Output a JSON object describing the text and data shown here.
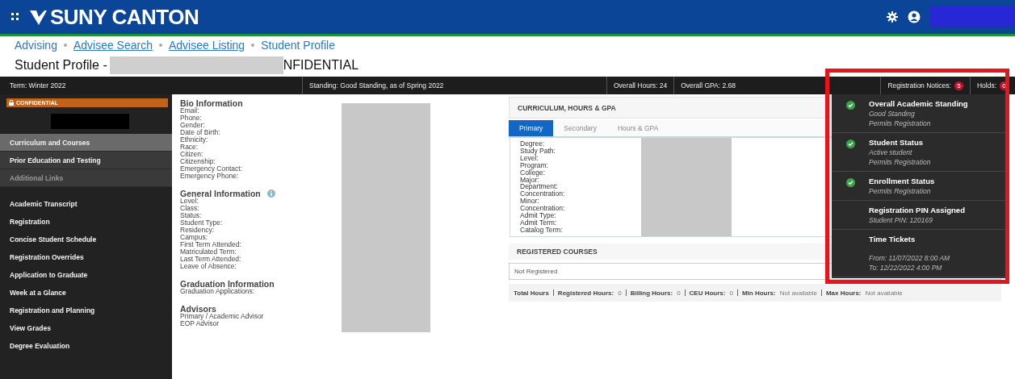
{
  "header": {
    "logo": "SUNY CANTON"
  },
  "breadcrumb": [
    {
      "label": "Advising",
      "link": false
    },
    {
      "label": "Advisee Search",
      "link": true
    },
    {
      "label": "Advisee Listing",
      "link": true
    },
    {
      "label": "Student Profile",
      "link": false
    }
  ],
  "page_title": {
    "prefix": "Student Profile -",
    "suffix": "NFIDENTIAL"
  },
  "info_bar": {
    "term": "Term: Winter 2022",
    "standing": "Standing: Good Standing, as of Spring 2022",
    "hours": "Overall Hours: 24",
    "gpa": "Overall GPA: 2.68",
    "notices_label": "Registration Notices:",
    "notices_count": "5",
    "holds_label": "Holds:",
    "holds_count": "0"
  },
  "sidebar": {
    "badge": "CONFIDENTIAL",
    "items": [
      {
        "label": "Curriculum and Courses",
        "kind": "section",
        "selected": true,
        "disabled": false
      },
      {
        "label": "Prior Education and Testing",
        "kind": "section",
        "selected": false,
        "disabled": false
      },
      {
        "label": "Additional Links",
        "kind": "section",
        "selected": false,
        "disabled": true
      },
      {
        "label": "Academic Transcript",
        "kind": "link",
        "selected": false,
        "disabled": false
      },
      {
        "label": "Registration",
        "kind": "link",
        "selected": false,
        "disabled": false
      },
      {
        "label": "Concise Student Schedule",
        "kind": "link",
        "selected": false,
        "disabled": false
      },
      {
        "label": "Registration Overrides",
        "kind": "link",
        "selected": false,
        "disabled": false
      },
      {
        "label": "Application to Graduate",
        "kind": "link",
        "selected": false,
        "disabled": false
      },
      {
        "label": "Week at a Glance",
        "kind": "link",
        "selected": false,
        "disabled": false
      },
      {
        "label": "Registration and Planning",
        "kind": "link",
        "selected": false,
        "disabled": false
      },
      {
        "label": "View Grades",
        "kind": "link",
        "selected": false,
        "disabled": false
      },
      {
        "label": "Degree Evaluation",
        "kind": "link",
        "selected": false,
        "disabled": false
      }
    ]
  },
  "bio": {
    "sections": [
      {
        "title": "Bio Information",
        "info": false,
        "fields": [
          "Email:",
          "Phone:",
          "Gender:",
          "Date of Birth:",
          "Ethnicity:",
          "Race:",
          "Citizen:",
          "Citizenship:",
          "Emergency Contact:",
          "Emergency Phone:"
        ]
      },
      {
        "title": "General Information",
        "info": true,
        "fields": [
          "Level:",
          "Class:",
          "Status:",
          "Student Type:",
          "Residency:",
          "Campus:",
          "First Term Attended:",
          "Matriculated Term:",
          "Last Term Attended:",
          "Leave of Absence:"
        ]
      },
      {
        "title": "Graduation Information",
        "info": false,
        "fields": [
          "Graduation Applications:"
        ]
      },
      {
        "title": "Advisors",
        "info": false,
        "fields": [
          "Primary / Academic Advisor",
          "EOP Advisor"
        ]
      }
    ]
  },
  "curriculum": {
    "title": "CURRICULUM, HOURS & GPA",
    "tabs": [
      {
        "label": "Primary",
        "selected": true
      },
      {
        "label": "Secondary",
        "selected": false
      },
      {
        "label": "Hours & GPA",
        "selected": false
      }
    ],
    "fields": [
      "Degree:",
      "Study Path:",
      "Level:",
      "Program:",
      "College:",
      "Major:",
      "Department:",
      "Concentration:",
      "Minor:",
      "Concentration:",
      "Admit Type:",
      "Admit Term:",
      "Catalog Term:"
    ]
  },
  "registered": {
    "title": "REGISTERED COURSES",
    "empty": "Not Registered",
    "totals": [
      {
        "label": "Total Hours"
      },
      {
        "label": "Registered Hours:",
        "value": "0"
      },
      {
        "label": "Billing Hours:",
        "value": "0"
      },
      {
        "label": "CEU Hours:",
        "value": "0"
      },
      {
        "label": "Min Hours:",
        "value": "Not available"
      },
      {
        "label": "Max Hours:",
        "value": "Not available"
      }
    ]
  },
  "notices": [
    {
      "title": "Overall Academic Standing",
      "kind": "status",
      "passed": true,
      "lines": [
        "Good Standing",
        "Permits Registration"
      ]
    },
    {
      "title": "Student Status",
      "kind": "status",
      "passed": true,
      "lines": [
        "Active student",
        "Permits Registration"
      ]
    },
    {
      "title": "Enrollment Status",
      "kind": "status",
      "passed": true,
      "lines": [
        "Permits Registration"
      ]
    },
    {
      "title": "Registration PIN Assigned",
      "kind": "status",
      "passed": false,
      "lines": [
        "Student PIN: 120169"
      ]
    },
    {
      "title": "Time Tickets",
      "kind": "schedule",
      "passed": false,
      "lines": [
        "From: 11/07/2022 8:00 AM",
        "To: 12/22/2022 4:00 PM"
      ]
    }
  ]
}
